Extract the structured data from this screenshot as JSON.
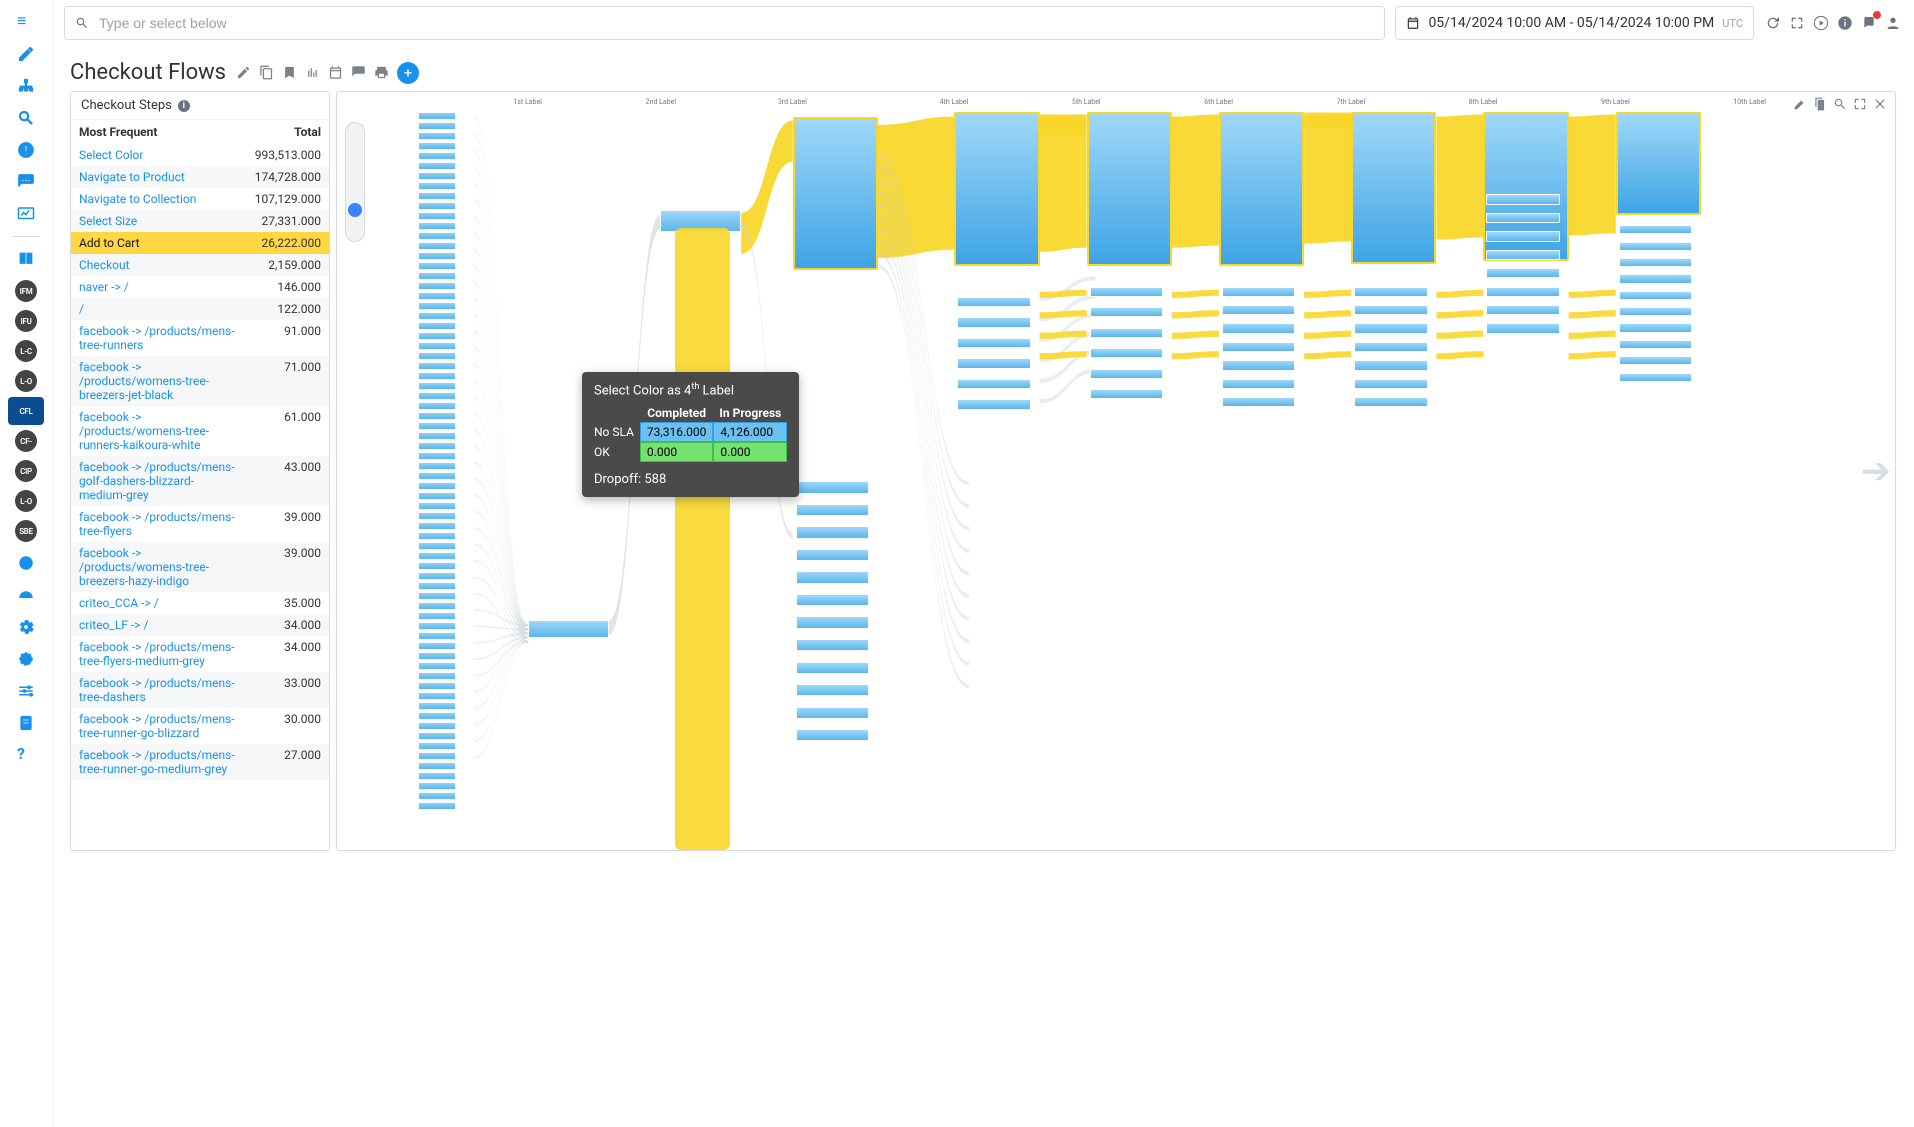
{
  "search": {
    "placeholder": "Type or select below"
  },
  "time_range": {
    "value": "05/14/2024 10:00 AM - 05/14/2024 10:00 PM",
    "tz": "UTC"
  },
  "page": {
    "title": "Checkout Flows"
  },
  "subpanel": {
    "title": "Checkout Steps"
  },
  "freq_table": {
    "col_label": "Most Frequent",
    "col_total": "Total",
    "rows": [
      {
        "label": "Select Color",
        "total": "993,513.000",
        "highlight": false
      },
      {
        "label": "Navigate to Product",
        "total": "174,728.000",
        "highlight": false
      },
      {
        "label": "Navigate to Collection",
        "total": "107,129.000",
        "highlight": false
      },
      {
        "label": "Select Size",
        "total": "27,331.000",
        "highlight": false
      },
      {
        "label": "Add to Cart",
        "total": "26,222.000",
        "highlight": true
      },
      {
        "label": "Checkout",
        "total": "2,159.000",
        "highlight": false
      },
      {
        "label": "naver -> /",
        "total": "146.000",
        "highlight": false
      },
      {
        "label": "/",
        "total": "122.000",
        "highlight": false
      },
      {
        "label": "facebook -> /products/mens-tree-runners",
        "total": "91.000",
        "highlight": false
      },
      {
        "label": "facebook -> /products/womens-tree-breezers-jet-black",
        "total": "71.000",
        "highlight": false
      },
      {
        "label": "facebook -> /products/womens-tree-runners-kaikoura-white",
        "total": "61.000",
        "highlight": false
      },
      {
        "label": "facebook -> /products/mens-golf-dashers-blizzard-medium-grey",
        "total": "43.000",
        "highlight": false
      },
      {
        "label": "facebook -> /products/mens-tree-flyers",
        "total": "39.000",
        "highlight": false
      },
      {
        "label": "facebook -> /products/womens-tree-breezers-hazy-indigo",
        "total": "39.000",
        "highlight": false
      },
      {
        "label": "criteo_CCA -> /",
        "total": "35.000",
        "highlight": false
      },
      {
        "label": "criteo_LF -> /",
        "total": "34.000",
        "highlight": false
      },
      {
        "label": "facebook -> /products/mens-tree-flyers-medium-grey",
        "total": "34.000",
        "highlight": false
      },
      {
        "label": "facebook -> /products/mens-tree-dashers",
        "total": "33.000",
        "highlight": false
      },
      {
        "label": "facebook -> /products/mens-tree-runner-go-blizzard",
        "total": "30.000",
        "highlight": false
      },
      {
        "label": "facebook -> /products/mens-tree-runner-go-medium-grey",
        "total": "27.000",
        "highlight": false
      }
    ]
  },
  "sankey": {
    "columns": [
      "1st Label",
      "2nd Label",
      "3rd Label",
      "4th Label",
      "5th Label",
      "6th Label",
      "7th Label",
      "8th Label",
      "9th Label",
      "10th Label"
    ]
  },
  "tooltip": {
    "title_prefix": "Select Color as 4",
    "title_suffix": " Label",
    "col_completed": "Completed",
    "col_in_progress": "In Progress",
    "rows": [
      {
        "label": "No SLA",
        "completed": "73,316.000",
        "in_progress": "4,126.000",
        "kind": "b"
      },
      {
        "label": "OK",
        "completed": "0.000",
        "in_progress": "0.000",
        "kind": "g"
      }
    ],
    "dropoff_label": "Dropoff: ",
    "dropoff_value": "588"
  },
  "leftnav": {
    "tags": [
      "IFM",
      "IFU",
      "L-C",
      "L-O",
      "CFL",
      "CF-",
      "CIP",
      "L-O",
      "SBE"
    ]
  }
}
